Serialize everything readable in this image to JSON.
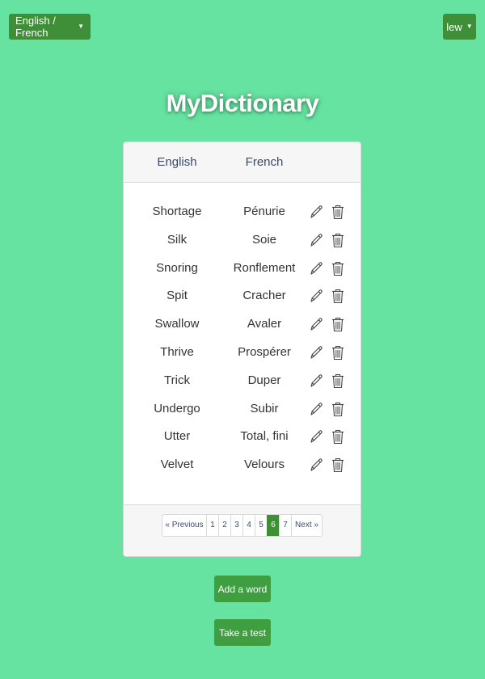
{
  "header": {
    "language_selector": "English / French",
    "user_menu": "lew"
  },
  "title": "MyDictionary",
  "table": {
    "columns": [
      "English",
      "French"
    ],
    "rows": [
      {
        "en": "Shortage",
        "fr": "Pénurie"
      },
      {
        "en": "Silk",
        "fr": "Soie"
      },
      {
        "en": "Snoring",
        "fr": "Ronflement"
      },
      {
        "en": "Spit",
        "fr": "Cracher"
      },
      {
        "en": "Swallow",
        "fr": "Avaler"
      },
      {
        "en": "Thrive",
        "fr": "Prospérer"
      },
      {
        "en": "Trick",
        "fr": "Duper"
      },
      {
        "en": "Undergo",
        "fr": "Subir"
      },
      {
        "en": "Utter",
        "fr": "Total, fini"
      },
      {
        "en": "Velvet",
        "fr": "Velours"
      }
    ],
    "row_icons": [
      "pencil-icon",
      "trash-icon"
    ]
  },
  "pagination": {
    "previous": "« Previous",
    "pages": [
      "1",
      "2",
      "3",
      "4",
      "5",
      "6",
      "7"
    ],
    "active_page": "6",
    "next": "Next »"
  },
  "actions": {
    "add_word": "Add a word",
    "take_test": "Take a test"
  },
  "colors": {
    "background": "#66e3a0",
    "button": "#3e8f37",
    "active_page": "#3e8f37"
  }
}
